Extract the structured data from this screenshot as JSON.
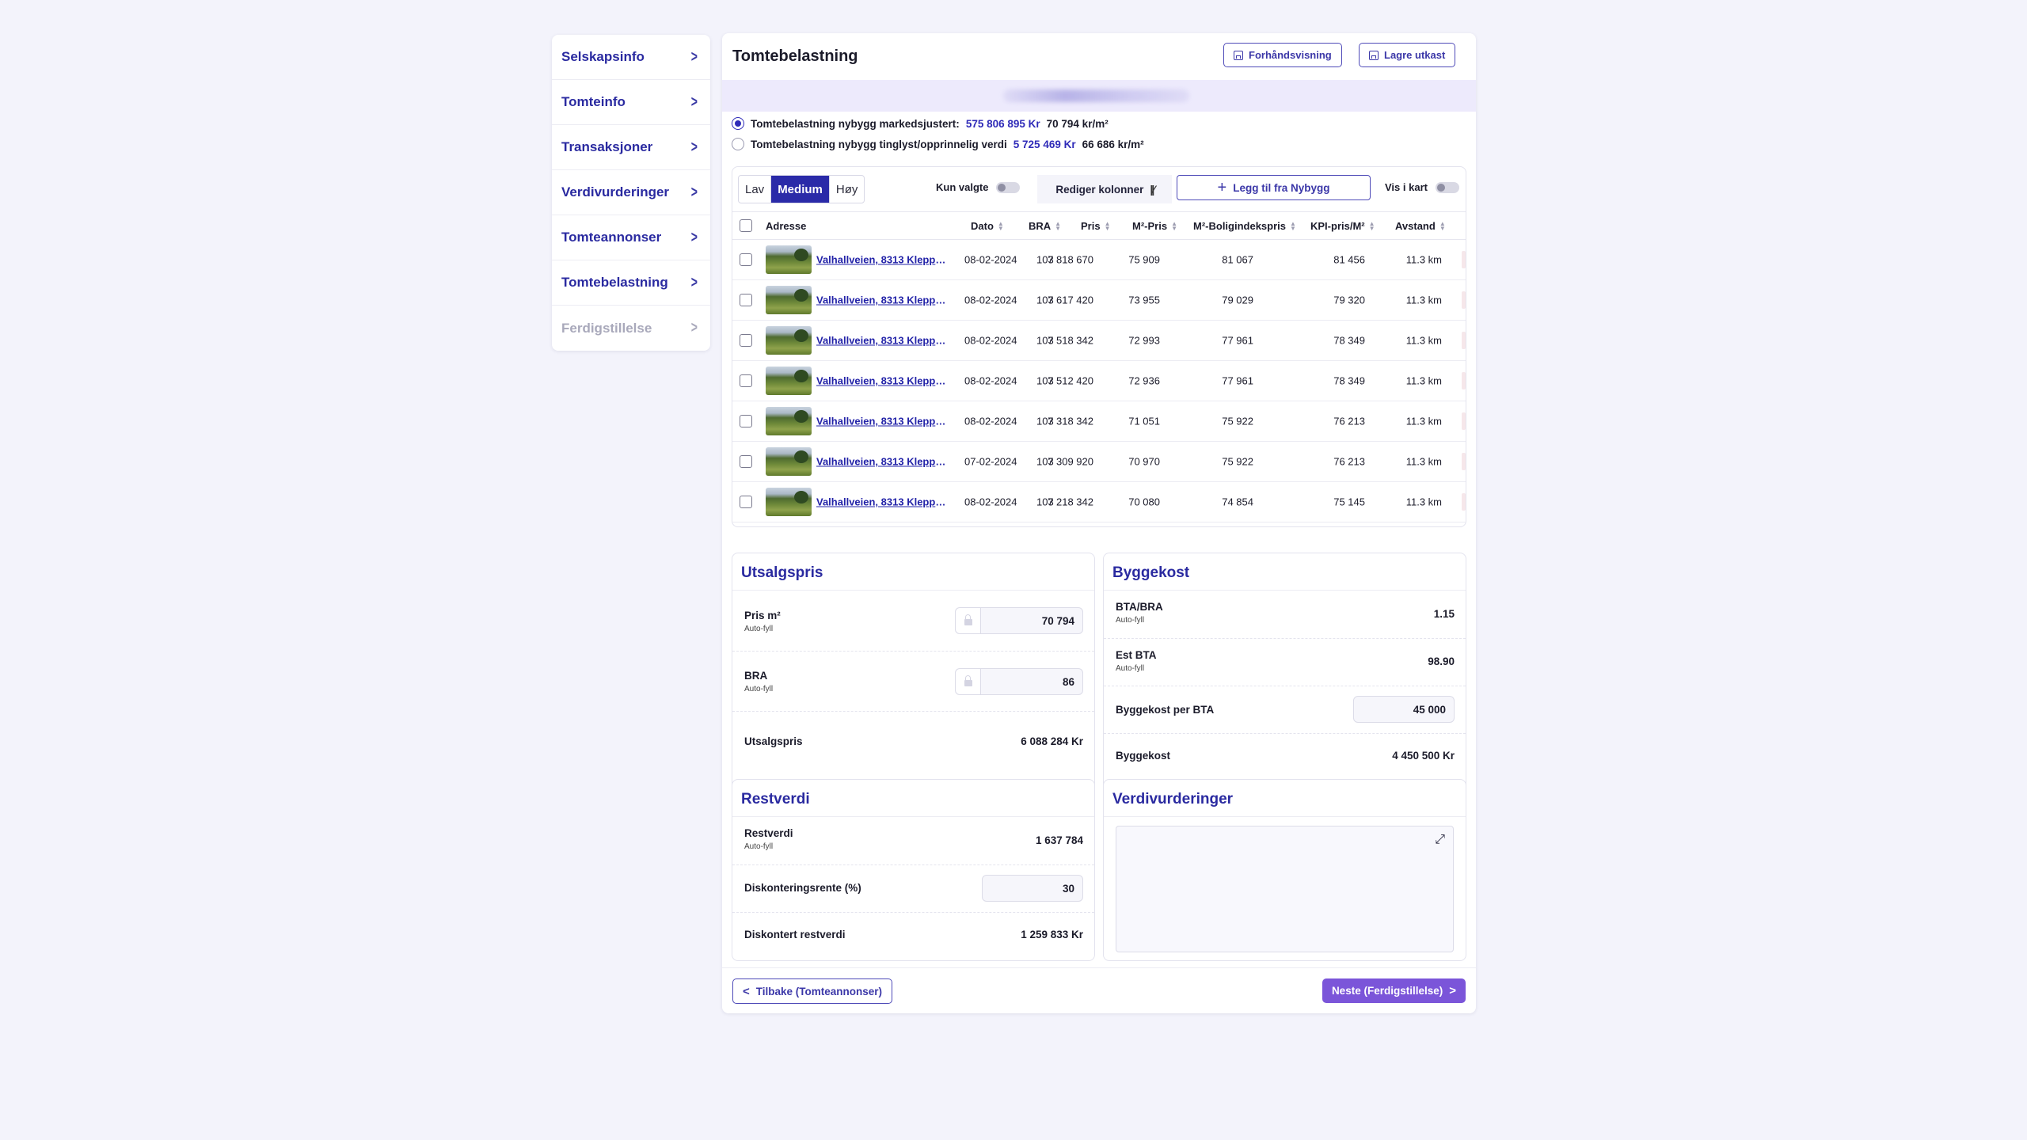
{
  "sidebar": {
    "items": [
      {
        "label": "Selskapsinfo",
        "disabled": false
      },
      {
        "label": "Tomteinfo",
        "disabled": false
      },
      {
        "label": "Transaksjoner",
        "disabled": false
      },
      {
        "label": "Verdivurderinger",
        "disabled": false
      },
      {
        "label": "Tomteannonser",
        "disabled": false
      },
      {
        "label": "Tomtebelastning",
        "disabled": false
      },
      {
        "label": "Ferdigstillelse",
        "disabled": true
      }
    ]
  },
  "header": {
    "title": "Tomtebelastning",
    "preview_label": "Forhåndsvisning",
    "save_draft_label": "Lagre utkast"
  },
  "options": {
    "market": {
      "label": "Tomtebelastning nybygg markedsjustert:",
      "amount": "575 806 895 Kr",
      "per_m2": "70 794 kr/m²",
      "selected": true
    },
    "registered": {
      "label": "Tomtebelastning nybygg tinglyst/opprinnelig verdi",
      "amount": "5 725 469 Kr",
      "per_m2": "66 686 kr/m²",
      "selected": false
    }
  },
  "table": {
    "segments": [
      "Lav",
      "Medium",
      "Høy"
    ],
    "active_segment": "Medium",
    "only_selected_label": "Kun valgte",
    "edit_columns_label": "Rediger kolonner",
    "add_button_label": "Legg til fra Nybygg",
    "show_on_map_label": "Vis i kart",
    "columns": {
      "address": "Adresse",
      "date": "Dato",
      "bra": "BRA",
      "price": "Pris",
      "m2_price": "M²-Pris",
      "index_price": "M²-Boligindekspris",
      "kpi_price": "KPI-pris/M²",
      "distance": "Avstand"
    },
    "rows": [
      {
        "address": "Valhallveien, 8313 Kleppst…",
        "date": "08-02-2024",
        "bra": "103",
        "price": "7 818 670",
        "m2_price": "75 909",
        "index_price": "81 067",
        "kpi_price": "81 456",
        "distance": "11.3 km"
      },
      {
        "address": "Valhallveien, 8313 Kleppst…",
        "date": "08-02-2024",
        "bra": "103",
        "price": "7 617 420",
        "m2_price": "73 955",
        "index_price": "79 029",
        "kpi_price": "79 320",
        "distance": "11.3 km"
      },
      {
        "address": "Valhallveien, 8313 Kleppst…",
        "date": "08-02-2024",
        "bra": "103",
        "price": "7 518 342",
        "m2_price": "72 993",
        "index_price": "77 961",
        "kpi_price": "78 349",
        "distance": "11.3 km"
      },
      {
        "address": "Valhallveien, 8313 Kleppst…",
        "date": "08-02-2024",
        "bra": "103",
        "price": "7 512 420",
        "m2_price": "72 936",
        "index_price": "77 961",
        "kpi_price": "78 349",
        "distance": "11.3 km"
      },
      {
        "address": "Valhallveien, 8313 Kleppst…",
        "date": "08-02-2024",
        "bra": "103",
        "price": "7 318 342",
        "m2_price": "71 051",
        "index_price": "75 922",
        "kpi_price": "76 213",
        "distance": "11.3 km"
      },
      {
        "address": "Valhallveien, 8313 Kleppst…",
        "date": "07-02-2024",
        "bra": "103",
        "price": "7 309 920",
        "m2_price": "70 970",
        "index_price": "75 922",
        "kpi_price": "76 213",
        "distance": "11.3 km"
      },
      {
        "address": "Valhallveien, 8313 Kleppst…",
        "date": "08-02-2024",
        "bra": "103",
        "price": "7 218 342",
        "m2_price": "70 080",
        "index_price": "74 854",
        "kpi_price": "75 145",
        "distance": "11.3 km"
      }
    ]
  },
  "utsalgspris": {
    "title": "Utsalgspris",
    "price_m2": {
      "label": "Pris m²",
      "sub": "Auto-fyll",
      "value": "70 794"
    },
    "bra": {
      "label": "BRA",
      "sub": "Auto-fyll",
      "value": "86"
    },
    "total": {
      "label": "Utsalgspris",
      "value": "6 088 284 Kr"
    }
  },
  "byggekost": {
    "title": "Byggekost",
    "bta_bra": {
      "label": "BTA/BRA",
      "sub": "Auto-fyll",
      "value": "1.15"
    },
    "est_bta": {
      "label": "Est BTA",
      "sub": "Auto-fyll",
      "value": "98.90"
    },
    "cost_per_bta": {
      "label": "Byggekost per BTA",
      "value": "45 000"
    },
    "total": {
      "label": "Byggekost",
      "value": "4 450 500 Kr"
    }
  },
  "restverdi": {
    "title": "Restverdi",
    "restverdi": {
      "label": "Restverdi",
      "sub": "Auto-fyll",
      "value": "1 637 784"
    },
    "discount_rate": {
      "label": "Diskonteringsrente (%)",
      "value": "30"
    },
    "discounted": {
      "label": "Diskontert restverdi",
      "value": "1 259 833 Kr"
    }
  },
  "verdivurderinger": {
    "title": "Verdivurderinger"
  },
  "footer": {
    "back_label": "Tilbake (Tomteannonser)",
    "next_label": "Neste (Ferdigstillelse)"
  },
  "colors": {
    "accent": "#2a2aa8",
    "primary_button": "#7b55d9",
    "banner": "#edeafc",
    "background": "#f3f3fb"
  }
}
